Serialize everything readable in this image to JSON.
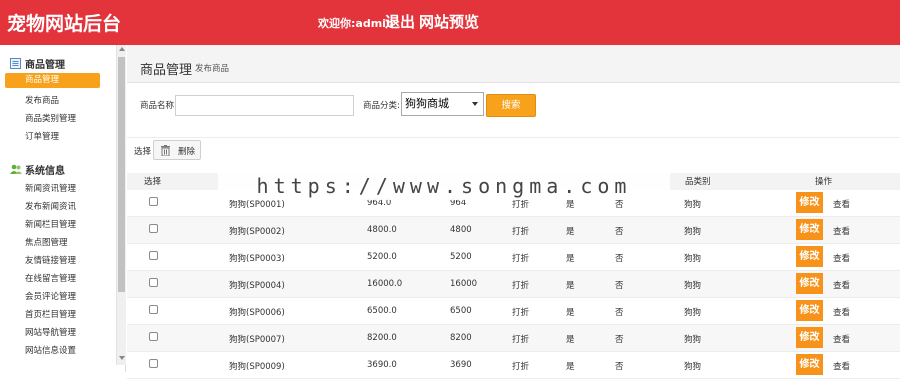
{
  "header": {
    "site_title": "宠物网站后台",
    "welcome": "欢迎你:admin",
    "logout": "退出",
    "preview": "网站预览"
  },
  "sidebar": {
    "groups": [
      {
        "title": "商品管理",
        "icon": "document-list-icon",
        "items": [
          "商品管理",
          "发布商品",
          "商品类别管理",
          "订单管理"
        ]
      },
      {
        "title": "系统信息",
        "icon": "users-icon",
        "items": [
          "新闻资讯管理",
          "发布新闻资讯",
          "新闻栏目管理",
          "焦点图管理",
          "友情链接管理",
          "在线留言管理",
          "会员评论管理",
          "首页栏目管理",
          "网站导航管理",
          "网站信息设置"
        ]
      }
    ],
    "active_item": "商品管理"
  },
  "page": {
    "title": "商品管理",
    "subtitle": "发布商品"
  },
  "search": {
    "name_label": "商品名称",
    "name_value": "",
    "category_label": "商品分类:",
    "category_value": "狗狗商城",
    "button": "搜索"
  },
  "toolbar": {
    "select_label": "选择",
    "delete_label": "删除"
  },
  "table": {
    "headers": {
      "select": "选择",
      "category": "品类别",
      "action": "操作"
    },
    "edit_label": "修改",
    "view_label": "查看",
    "rows": [
      {
        "name": "狗狗(SP0001)",
        "price1": "964.0",
        "price2": "964",
        "discount": "打折",
        "flag1": "是",
        "flag2": "否",
        "category": "狗狗"
      },
      {
        "name": "狗狗(SP0002)",
        "price1": "4800.0",
        "price2": "4800",
        "discount": "打折",
        "flag1": "是",
        "flag2": "否",
        "category": "狗狗"
      },
      {
        "name": "狗狗(SP0003)",
        "price1": "5200.0",
        "price2": "5200",
        "discount": "打折",
        "flag1": "是",
        "flag2": "否",
        "category": "狗狗"
      },
      {
        "name": "狗狗(SP0004)",
        "price1": "16000.0",
        "price2": "16000",
        "discount": "打折",
        "flag1": "是",
        "flag2": "否",
        "category": "狗狗"
      },
      {
        "name": "狗狗(SP0006)",
        "price1": "6500.0",
        "price2": "6500",
        "discount": "打折",
        "flag1": "是",
        "flag2": "否",
        "category": "狗狗"
      },
      {
        "name": "狗狗(SP0007)",
        "price1": "8200.0",
        "price2": "8200",
        "discount": "打折",
        "flag1": "是",
        "flag2": "否",
        "category": "狗狗"
      },
      {
        "name": "狗狗(SP0009)",
        "price1": "3690.0",
        "price2": "3690",
        "discount": "打折",
        "flag1": "是",
        "flag2": "否",
        "category": "狗狗"
      }
    ]
  },
  "watermark": "https://www.songma.com",
  "colors": {
    "header_red": "#e3333b",
    "accent_orange": "#f7a21a"
  }
}
